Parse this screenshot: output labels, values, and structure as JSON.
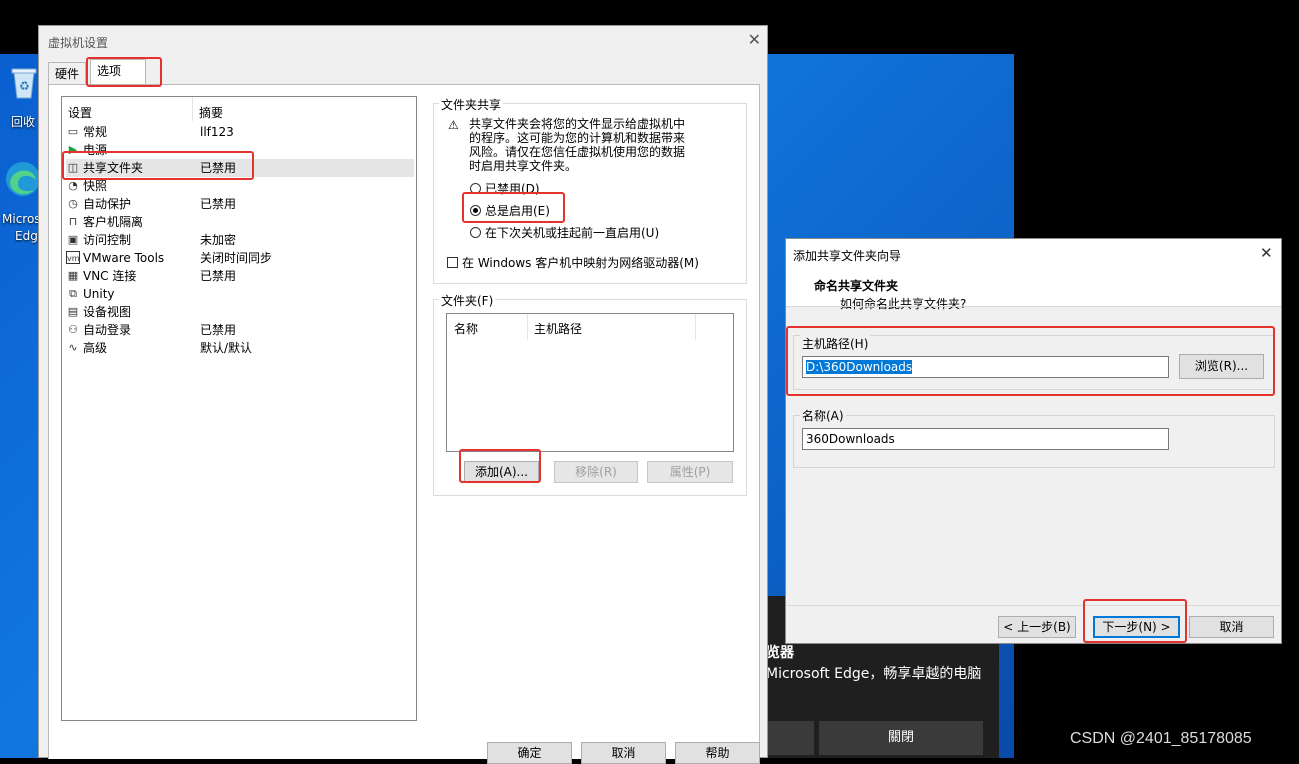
{
  "desktop": {
    "recycle_label": "回收",
    "edge_label_1": "Micros",
    "edge_label_2": "Edg",
    "toast": {
      "title": "览器",
      "body": "Microsoft Edge，畅享卓越的电脑",
      "close_label": "關閉"
    },
    "watermark": "CSDN @2401_85178085"
  },
  "vm_settings": {
    "title": "虚拟机设置",
    "close": "✕",
    "tabs": [
      "硬件",
      "选项"
    ],
    "selected_tab": "选项",
    "list_headers": {
      "setting": "设置",
      "summary": "摘要"
    },
    "items": [
      {
        "icon": "general-icon",
        "glyph": "▭",
        "name": "常规",
        "summary": "llf123"
      },
      {
        "icon": "power-icon",
        "glyph": "▶",
        "name": "电源",
        "summary": ""
      },
      {
        "icon": "shared-folder-icon",
        "glyph": "◫",
        "name": "共享文件夹",
        "summary": "已禁用"
      },
      {
        "icon": "snapshot-icon",
        "glyph": "◔",
        "name": "快照",
        "summary": ""
      },
      {
        "icon": "autoprotect-icon",
        "glyph": "◷",
        "name": "自动保护",
        "summary": "已禁用"
      },
      {
        "icon": "isolation-icon",
        "glyph": "⊓",
        "name": "客户机隔离",
        "summary": ""
      },
      {
        "icon": "access-control-icon",
        "glyph": "▣",
        "name": "访问控制",
        "summary": "未加密"
      },
      {
        "icon": "vmware-tools-icon",
        "glyph": "vm",
        "name": "VMware Tools",
        "summary": "关闭时间同步"
      },
      {
        "icon": "vnc-icon",
        "glyph": "▦",
        "name": "VNC 连接",
        "summary": "已禁用"
      },
      {
        "icon": "unity-icon",
        "glyph": "⧉",
        "name": "Unity",
        "summary": ""
      },
      {
        "icon": "device-view-icon",
        "glyph": "▤",
        "name": "设备视图",
        "summary": ""
      },
      {
        "icon": "autologin-icon",
        "glyph": "⚇",
        "name": "自动登录",
        "summary": "已禁用"
      },
      {
        "icon": "advanced-icon",
        "glyph": "∿",
        "name": "高级",
        "summary": "默认/默认"
      }
    ],
    "selected_item": "共享文件夹",
    "sharing_group": {
      "label": "文件夹共享",
      "warning": [
        "共享文件夹会将您的文件显示给虚拟机中",
        "的程序。这可能为您的计算机和数据带来",
        "风险。请仅在您信任虚拟机使用您的数据",
        "时启用共享文件夹。"
      ],
      "options": [
        "已禁用(D)",
        "总是启用(E)",
        "在下次关机或挂起前一直启用(U)"
      ],
      "selected_option": "总是启用(E)",
      "map_drive": "在 Windows 客户机中映射为网络驱动器(M)"
    },
    "folders_group": {
      "label": "文件夹(F)",
      "columns": [
        "名称",
        "主机路径"
      ],
      "add": "添加(A)...",
      "remove": "移除(R)",
      "properties": "属性(P)"
    },
    "footer": {
      "ok": "确定",
      "cancel": "取消",
      "help": "帮助"
    }
  },
  "wizard": {
    "title": "添加共享文件夹向导",
    "close": "✕",
    "heading": "命名共享文件夹",
    "subheading": "如何命名此共享文件夹?",
    "host_path_label": "主机路径(H)",
    "host_path_value": "D:\\360Downloads",
    "browse": "浏览(R)...",
    "name_label": "名称(A)",
    "name_value": "360Downloads",
    "back": "< 上一步(B)",
    "next": "下一步(N) >",
    "cancel": "取消"
  }
}
